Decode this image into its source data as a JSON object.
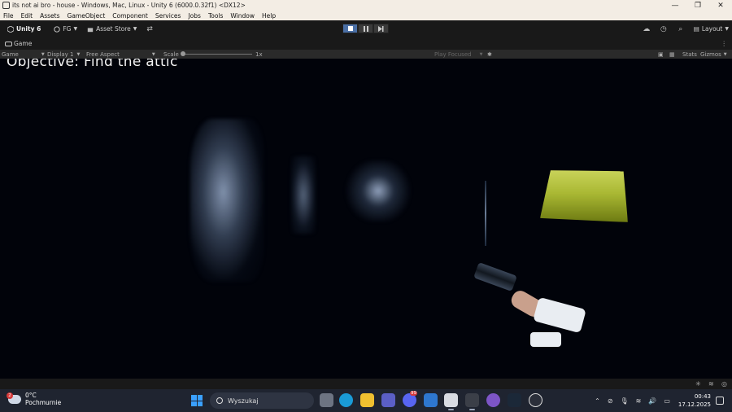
{
  "window": {
    "title": "its not ai bro - house - Windows, Mac, Linux - Unity 6 (6000.0.32f1) <DX12>",
    "minimize": "—",
    "maximize": "❐",
    "close": "✕"
  },
  "menu": [
    "File",
    "Edit",
    "Assets",
    "GameObject",
    "Component",
    "Services",
    "Jobs",
    "Tools",
    "Window",
    "Help"
  ],
  "toolbar": {
    "unity_label": "Unity 6",
    "account_label": "FG",
    "asset_store_label": "Asset Store",
    "layout_label": "Layout"
  },
  "tab": {
    "label": "Game"
  },
  "gamebar": {
    "view_mode": "Game",
    "display": "Display 1",
    "aspect": "Free Aspect",
    "scale_label": "Scale",
    "scale_value": "1x",
    "play_mode": "Play Focused",
    "stats_label": "Stats",
    "gizmos_label": "Gizmos"
  },
  "game": {
    "objective_text": "Objective: Find the attic"
  },
  "taskbar": {
    "weather_temp": "0°C",
    "weather_desc": "Pochmurnie",
    "weather_badge": "2",
    "search_placeholder": "Wyszukaj",
    "discord_badge": "99",
    "time": "00:43",
    "date": "17.12.2025"
  },
  "colors": {
    "attic_light": "#b8c63c",
    "play_active": "#4a6fa5",
    "taskbar_bg": "#1f2430"
  }
}
